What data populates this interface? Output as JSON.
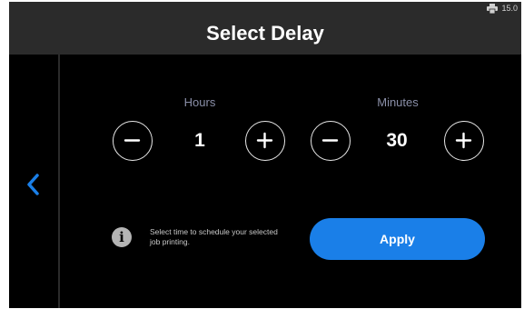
{
  "status_bar": {
    "icon": "printer-icon",
    "text": "15.0"
  },
  "title": "Select Delay",
  "back": {
    "icon": "chevron-left-icon"
  },
  "hours": {
    "label": "Hours",
    "value": "1"
  },
  "minutes": {
    "label": "Minutes",
    "value": "30"
  },
  "info": {
    "icon": "info-icon",
    "glyph": "i",
    "text": "Select time to schedule your selected job printing."
  },
  "apply_label": "Apply",
  "colors": {
    "accent": "#1a7fe8",
    "background": "#000000",
    "header": "#2b2b2b",
    "label": "#8a8fa8"
  }
}
